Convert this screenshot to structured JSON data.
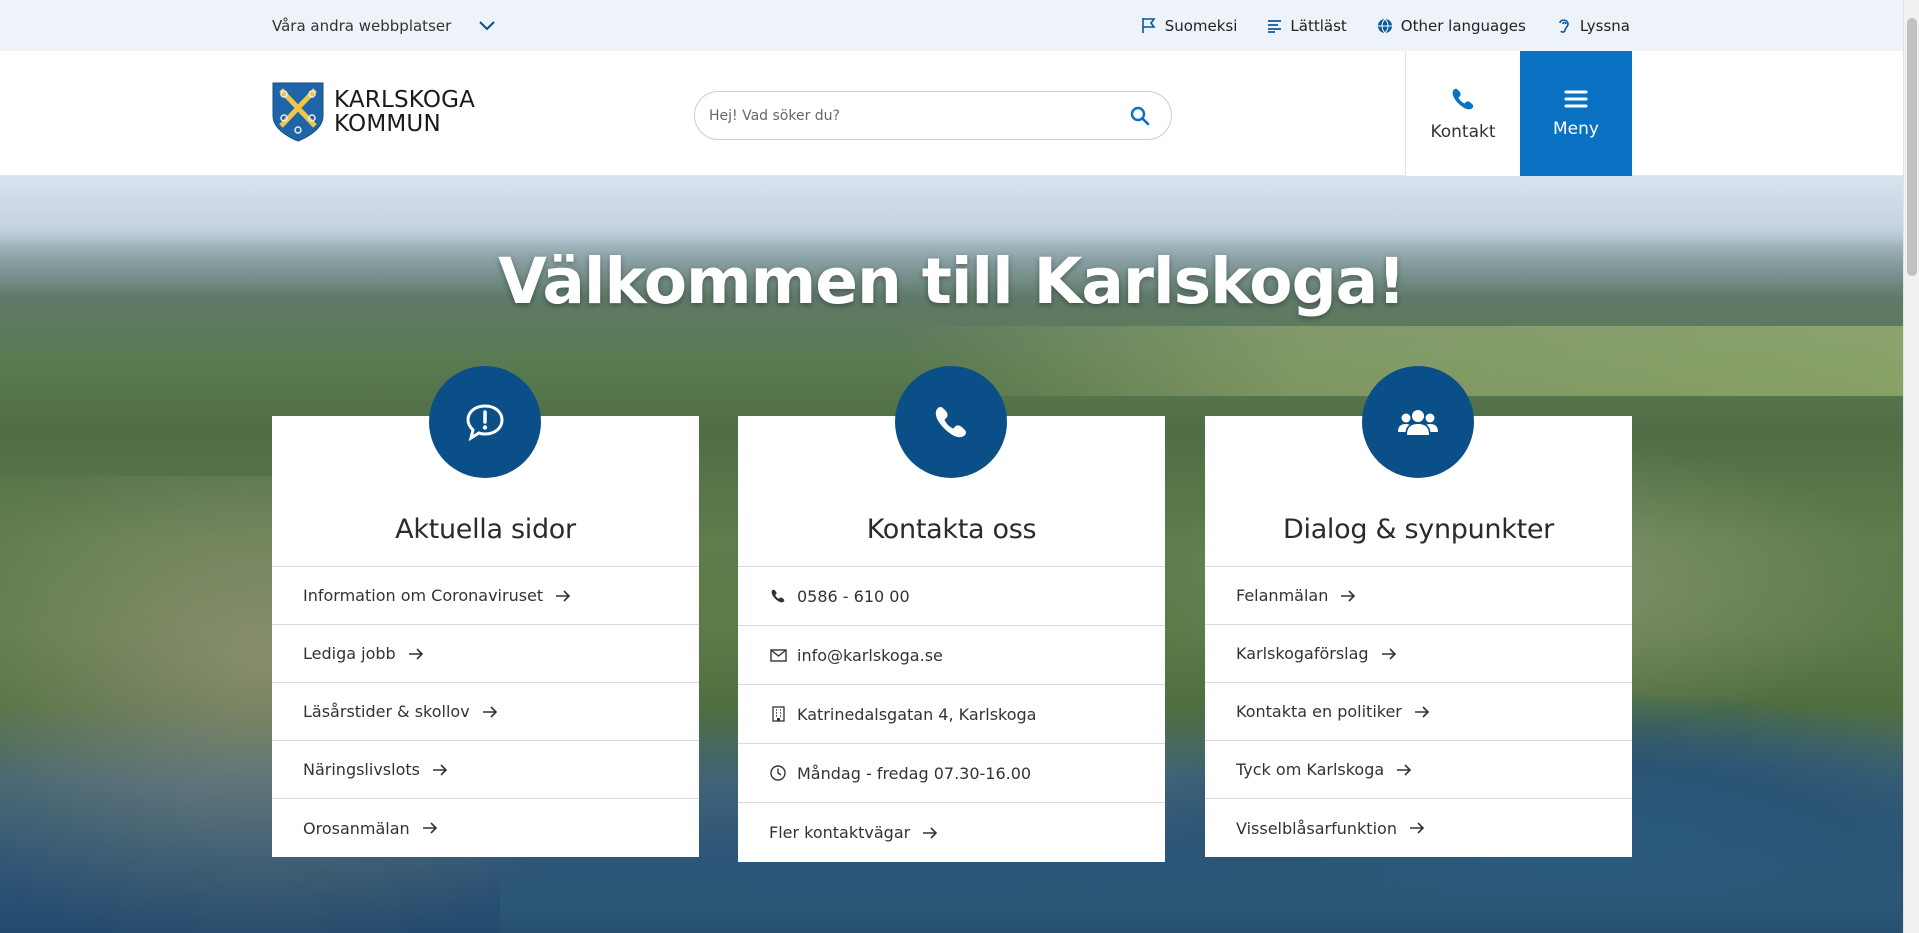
{
  "topbar": {
    "other_sites_label": "Våra andra webbplatser",
    "utilities": [
      {
        "label": "Suomeksi",
        "icon": "flag-icon"
      },
      {
        "label": "Lättläst",
        "icon": "lines-icon"
      },
      {
        "label": "Other languages",
        "icon": "globe-icon"
      },
      {
        "label": "Lyssna",
        "icon": "ear-icon"
      }
    ]
  },
  "header": {
    "logo_line1": "KARLSKOGA",
    "logo_line2": "KOMMUN",
    "search_placeholder": "Hej! Vad söker du?",
    "contact_label": "Kontakt",
    "menu_label": "Meny"
  },
  "hero": {
    "title": "Välkommen till Karlskoga!"
  },
  "cards": [
    {
      "title": "Aktuella sidor",
      "icon": "speech-bubble-exclamation-icon",
      "links": [
        "Information om Coronaviruset",
        "Lediga jobb",
        "Läsårstider & skollov",
        "Näringslivslots",
        "Orosanmälan"
      ]
    },
    {
      "title": "Kontakta oss",
      "icon": "phone-icon",
      "items": [
        {
          "icon": "phone-icon",
          "text": "0586 - 610 00"
        },
        {
          "icon": "envelope-icon",
          "text": "info@karlskoga.se"
        },
        {
          "icon": "building-icon",
          "text": "Katrinedalsgatan 4, Karlskoga"
        },
        {
          "icon": "clock-icon",
          "text": "Måndag - fredag 07.30-16.00"
        }
      ],
      "more_link": "Fler kontaktvägar"
    },
    {
      "title": "Dialog & synpunkter",
      "icon": "users-icon",
      "links": [
        "Felanmälan",
        "Karlskogaförslag",
        "Kontakta en politiker",
        "Tyck om Karlskoga",
        "Visselblåsarfunktion"
      ]
    }
  ],
  "colors": {
    "brand_blue": "#0a72c3",
    "badge_blue": "#0b4f89",
    "topbar_bg": "#edf3f8"
  }
}
